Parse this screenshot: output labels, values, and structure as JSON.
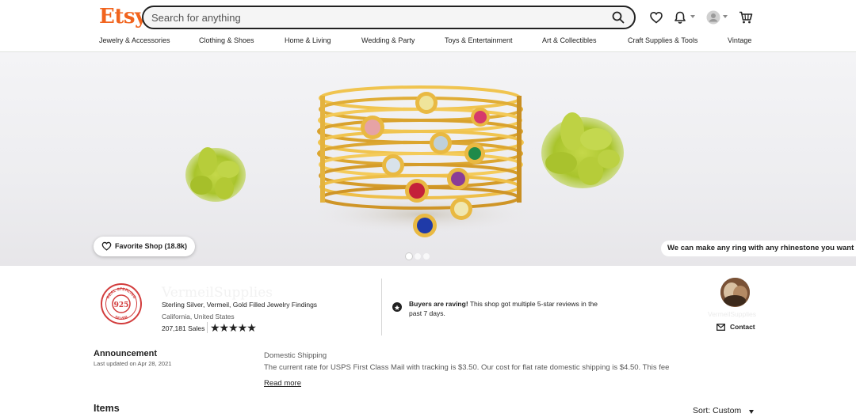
{
  "header": {
    "logo": "Etsy",
    "search_placeholder": "Search for anything",
    "icons": [
      "search-icon",
      "heart-icon",
      "bell-icon",
      "user-avatar-icon",
      "cart-icon"
    ]
  },
  "nav": {
    "items": [
      "Jewelry & Accessories",
      "Clothing & Shoes",
      "Home & Living",
      "Wedding & Party",
      "Toys & Entertainment",
      "Art & Collectibles",
      "Craft Supplies & Tools",
      "Vintage"
    ]
  },
  "banner": {
    "favorite_label": "Favorite Shop (18.8k)",
    "caption": "We can make any ring with any rhinestone you want",
    "slide_count": 3,
    "active_slide": 0
  },
  "shop": {
    "name": "VermeilSupplies",
    "tagline": "Sterling Silver, Vermeil, Gold Filled Jewelry Findings",
    "location": "California, United States",
    "sales": "207,181 Sales",
    "stars": "★★★★★",
    "logo_text_top": "REAL STERLING",
    "logo_text_center": "925",
    "logo_text_bottom": "SILVER",
    "raving_bold": "Buyers are raving!",
    "raving_text": " This shop got multiple 5-star reviews in the past 7 days.",
    "owner_name": "VermeilSupplies",
    "contact_label": "Contact"
  },
  "announcement": {
    "title": "Announcement",
    "date": "Last updated on Apr 28, 2021",
    "heading": "Domestic Shipping",
    "text": "The current rate for USPS First Class Mail with tracking is $3.50. Our cost for flat rate domestic shipping is $4.50. This fee",
    "read_more": "Read more"
  },
  "items": {
    "title": "Items",
    "sort_label": "Sort: Custom"
  },
  "colors": {
    "brand": "#f1641e",
    "logo_red": "#d23c3c",
    "gold": "#e2b13c"
  }
}
